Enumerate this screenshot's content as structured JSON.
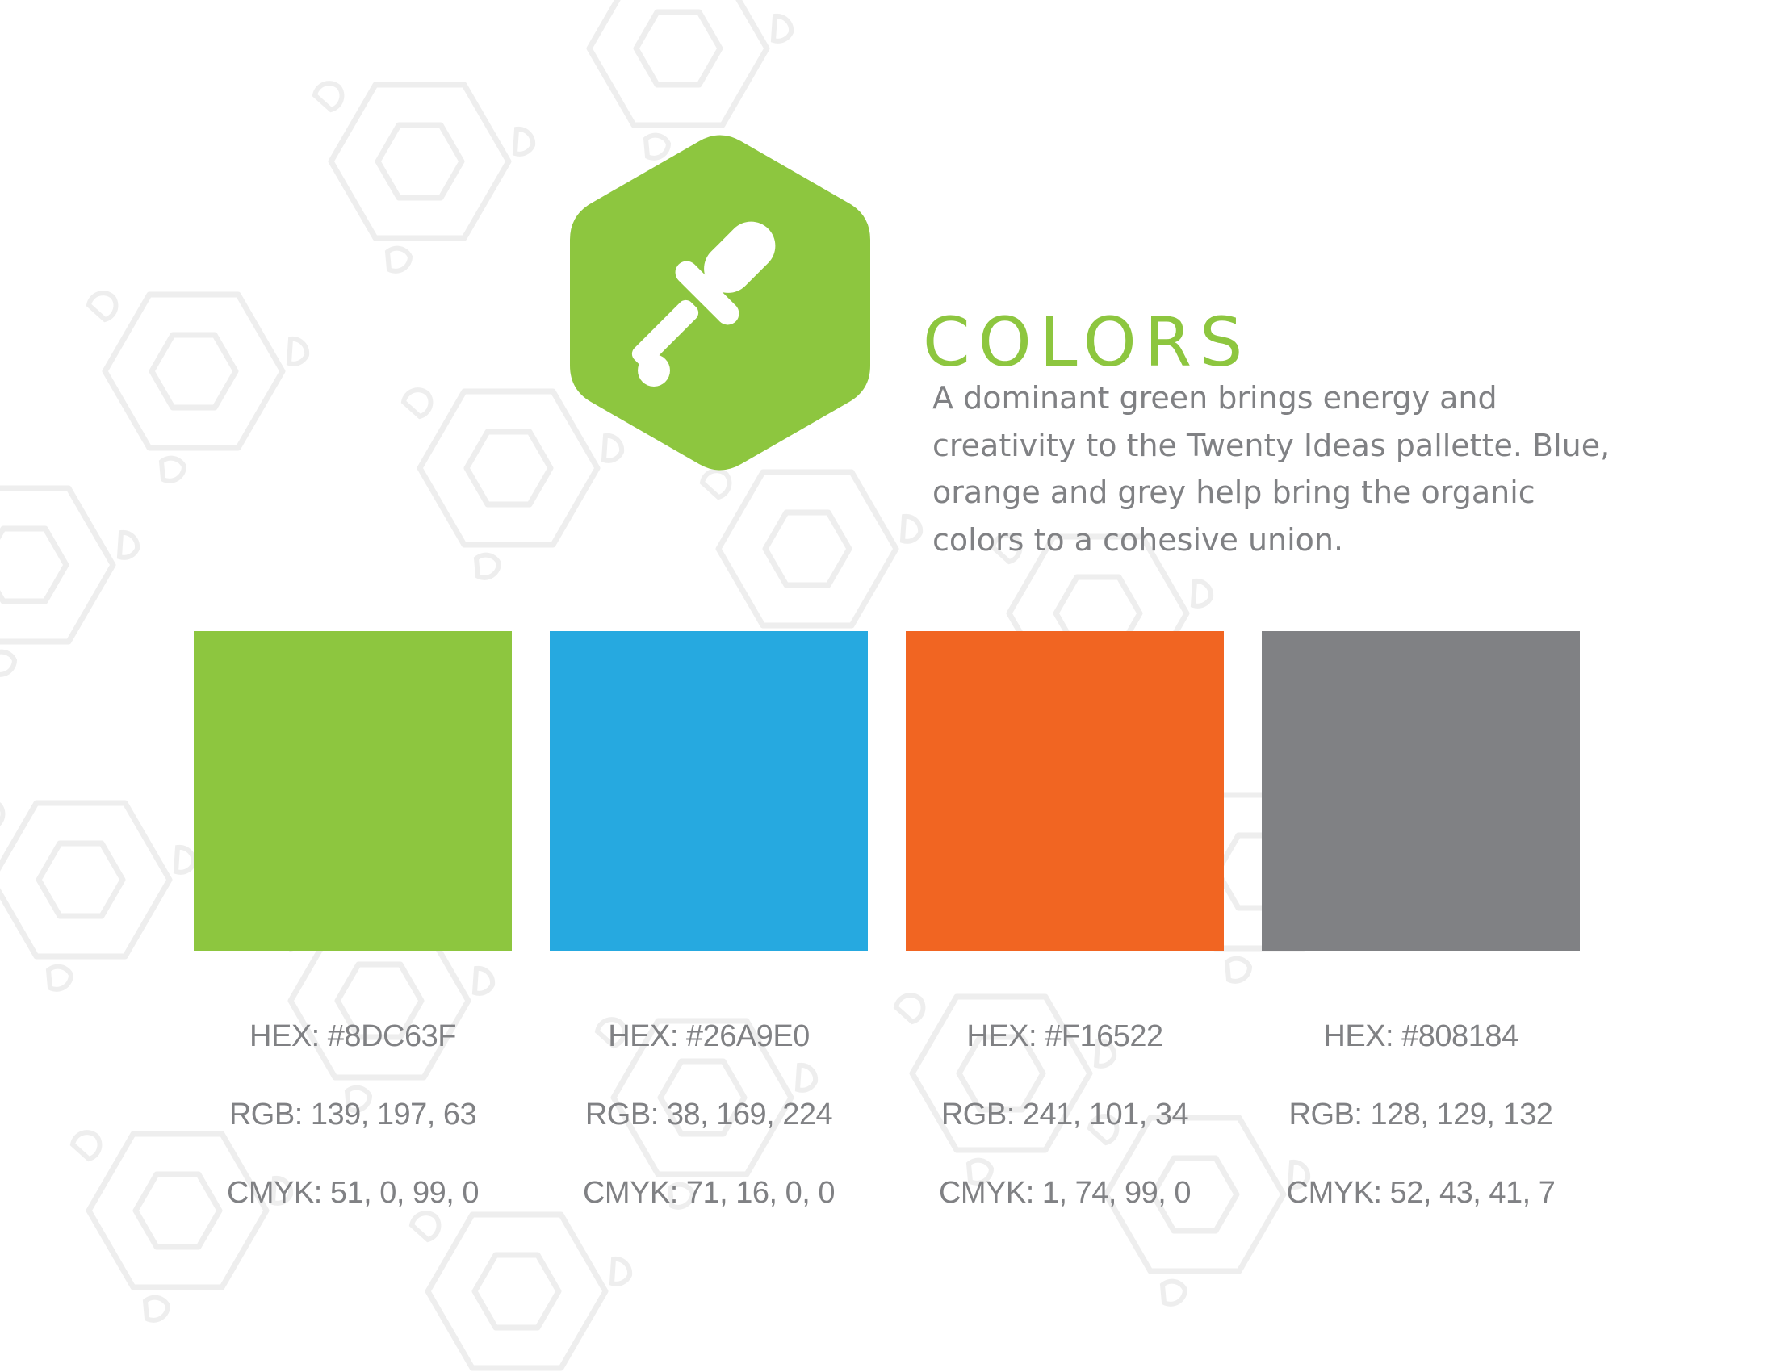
{
  "header": {
    "title": "COLORS",
    "description_lines": [
      "A dominant green brings energy and",
      "creativity to the Twenty Ideas pallette. Blue,",
      "orange and grey help bring the organic",
      "colors to a cohesive union."
    ]
  },
  "icon": {
    "name": "eyedropper-icon",
    "container": "hexagon",
    "color": "#8DC63F"
  },
  "palette": [
    {
      "name": "green",
      "color": "#8DC63F",
      "hex_label": "HEX: #8DC63F",
      "rgb_label": "RGB: 139, 197, 63",
      "cmyk_label": "CMYK: 51, 0, 99, 0"
    },
    {
      "name": "blue",
      "color": "#26A9E0",
      "hex_label": "HEX: #26A9E0",
      "rgb_label": "RGB: 38, 169, 224",
      "cmyk_label": "CMYK: 71, 16, 0, 0"
    },
    {
      "name": "orange",
      "color": "#F16522",
      "hex_label": "HEX: #F16522",
      "rgb_label": "RGB: 241, 101, 34",
      "cmyk_label": "CMYK: 1, 74, 99, 0"
    },
    {
      "name": "grey",
      "color": "#808184",
      "hex_label": "HEX: #808184",
      "rgb_label": "RGB: 128, 129, 132",
      "cmyk_label": "CMYK: 52, 43, 41, 7"
    }
  ],
  "colors": {
    "text": "#808184",
    "accent": "#8DC63F",
    "pattern": "#EEEEEE"
  }
}
